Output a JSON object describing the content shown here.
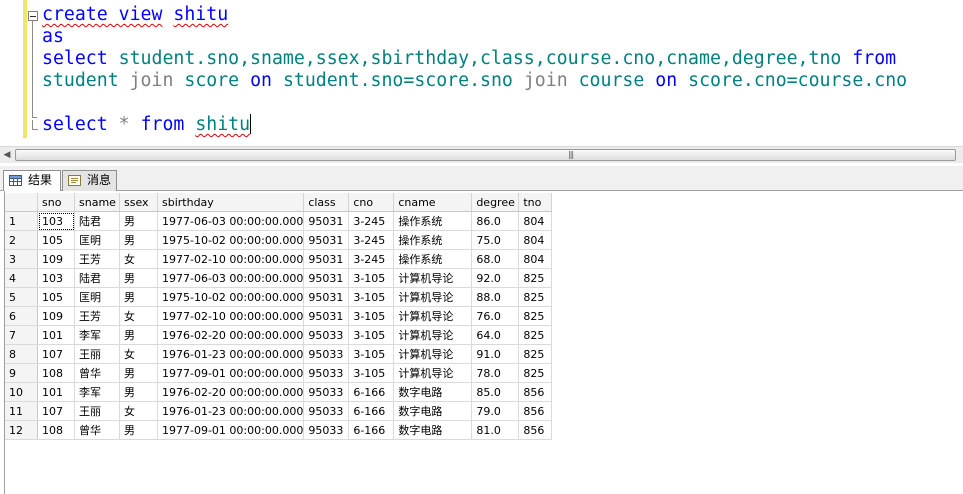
{
  "editor": {
    "line1": {
      "kw": "create view",
      "name": "shitu"
    },
    "line2": {
      "kw": "as"
    },
    "line3": {
      "kw_select": "select",
      "cols": "student.sno,sname,ssex,sbirthday,class,course.cno,cname,degree,tno",
      "kw_from": "from"
    },
    "line4": {
      "t1": "student",
      "j1": "join",
      "t2": "score",
      "on1": "on",
      "cond1": "student.sno=score.sno",
      "j2": "join",
      "t3": "course",
      "on2": "on",
      "cond2": "score.cno=course.cno"
    },
    "line6": {
      "kw_select": "select",
      "star": "*",
      "kw_from": "from",
      "name": "shitu"
    }
  },
  "scrollbar": {
    "grip": "|||"
  },
  "tabs": {
    "results": "结果",
    "messages": "消息"
  },
  "grid": {
    "columns": [
      "sno",
      "sname",
      "ssex",
      "sbirthday",
      "class",
      "cno",
      "cname",
      "degree",
      "tno"
    ],
    "rows": [
      [
        "1",
        "103",
        "陆君",
        "男",
        "1977-06-03 00:00:00.000",
        "95031",
        "3-245",
        "操作系统",
        "86.0",
        "804"
      ],
      [
        "2",
        "105",
        "匡明",
        "男",
        "1975-10-02 00:00:00.000",
        "95031",
        "3-245",
        "操作系统",
        "75.0",
        "804"
      ],
      [
        "3",
        "109",
        "王芳",
        "女",
        "1977-02-10 00:00:00.000",
        "95031",
        "3-245",
        "操作系统",
        "68.0",
        "804"
      ],
      [
        "4",
        "103",
        "陆君",
        "男",
        "1977-06-03 00:00:00.000",
        "95031",
        "3-105",
        "计算机导论",
        "92.0",
        "825"
      ],
      [
        "5",
        "105",
        "匡明",
        "男",
        "1975-10-02 00:00:00.000",
        "95031",
        "3-105",
        "计算机导论",
        "88.0",
        "825"
      ],
      [
        "6",
        "109",
        "王芳",
        "女",
        "1977-02-10 00:00:00.000",
        "95031",
        "3-105",
        "计算机导论",
        "76.0",
        "825"
      ],
      [
        "7",
        "101",
        "李军",
        "男",
        "1976-02-20 00:00:00.000",
        "95033",
        "3-105",
        "计算机导论",
        "64.0",
        "825"
      ],
      [
        "8",
        "107",
        "王丽",
        "女",
        "1976-01-23 00:00:00.000",
        "95033",
        "3-105",
        "计算机导论",
        "91.0",
        "825"
      ],
      [
        "9",
        "108",
        "曾华",
        "男",
        "1977-09-01 00:00:00.000",
        "95033",
        "3-105",
        "计算机导论",
        "78.0",
        "825"
      ],
      [
        "10",
        "101",
        "李军",
        "男",
        "1976-02-20 00:00:00.000",
        "95033",
        "6-166",
        "数字电路",
        "85.0",
        "856"
      ],
      [
        "11",
        "107",
        "王丽",
        "女",
        "1976-01-23 00:00:00.000",
        "95033",
        "6-166",
        "数字电路",
        "79.0",
        "856"
      ],
      [
        "12",
        "108",
        "曾华",
        "男",
        "1977-09-01 00:00:00.000",
        "95033",
        "6-166",
        "数字电路",
        "81.0",
        "856"
      ]
    ]
  },
  "colors": {
    "keyword": "#0000ff",
    "identifier": "#008080",
    "join": "#808080",
    "squiggle": "#e00000",
    "gutter": "#f6e36c"
  }
}
